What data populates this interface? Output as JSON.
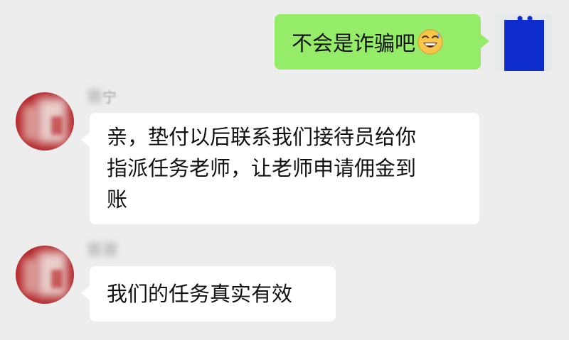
{
  "messages": [
    {
      "side": "right",
      "text": "不会是诈骗吧",
      "emoji": "grinning-face-with-sweat",
      "bubble_color": "#95ec69"
    },
    {
      "side": "left",
      "nickname_visible_char": "宁",
      "lines": [
        "亲，垫付以后联系我们接待员给你",
        "指派任务老师，让老师申请佣金到",
        "账"
      ]
    },
    {
      "side": "left",
      "nickname_visible_char": "",
      "text": "我们的任务真实有效"
    }
  ],
  "colors": {
    "background": "#ededed",
    "self_bubble": "#95ec69",
    "other_bubble": "#ffffff",
    "other_avatar": "#b3252a",
    "self_avatar_accent": "#0d2ccb"
  }
}
